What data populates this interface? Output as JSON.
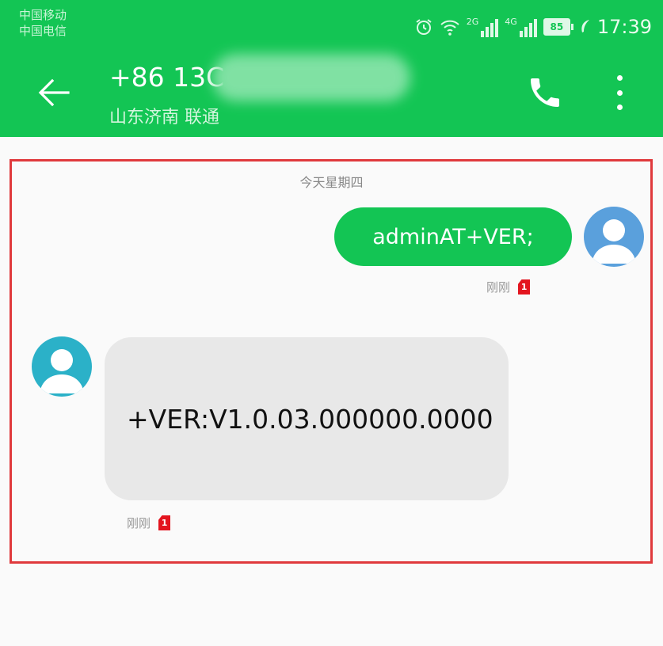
{
  "status_bar": {
    "carrier1": "中国移动",
    "carrier2": "中国电信",
    "sim1_network": "2G",
    "sim2_network": "4G",
    "battery": "85",
    "time": "17:39"
  },
  "header": {
    "title": "+86 13C",
    "subtitle": "山东济南 联通",
    "back_icon": "arrow-left-icon",
    "call_icon": "phone-icon",
    "more_icon": "more-vertical-icon",
    "background_color": "#13c554"
  },
  "conversation": {
    "date_label": "今天星期四",
    "messages": [
      {
        "direction": "outgoing",
        "text": "adminAT+VER;",
        "time": "刚刚",
        "sim": "1"
      },
      {
        "direction": "incoming",
        "text": "+VER:V1.0.03.000000.0000",
        "time": "刚刚",
        "sim": "1"
      }
    ],
    "highlight_color": "#e0393c"
  }
}
